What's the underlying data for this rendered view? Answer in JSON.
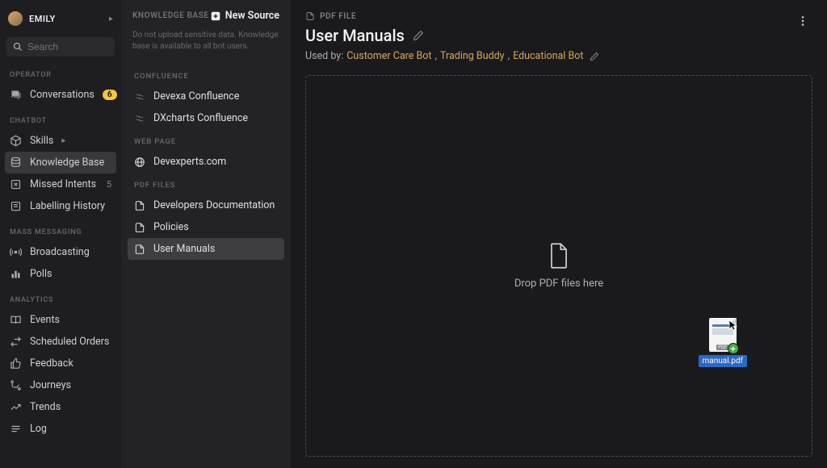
{
  "user": {
    "name": "EMILY"
  },
  "search": {
    "placeholder": "Search"
  },
  "sidebar_sections": {
    "operator": {
      "label": "OPERATOR"
    },
    "chatbot": {
      "label": "CHATBOT"
    },
    "mass_messaging": {
      "label": "MASS MESSAGING"
    },
    "analytics": {
      "label": "ANALYTICS"
    }
  },
  "nav": {
    "conversations": {
      "label": "Conversations",
      "badge": "6"
    },
    "skills": {
      "label": "Skills"
    },
    "knowledge_base": {
      "label": "Knowledge Base"
    },
    "missed_intents": {
      "label": "Missed Intents",
      "count": "5"
    },
    "labelling_history": {
      "label": "Labelling History"
    },
    "broadcasting": {
      "label": "Broadcasting"
    },
    "polls": {
      "label": "Polls"
    },
    "events": {
      "label": "Events"
    },
    "scheduled_orders": {
      "label": "Scheduled Orders"
    },
    "feedback": {
      "label": "Feedback"
    },
    "journeys": {
      "label": "Journeys"
    },
    "trends": {
      "label": "Trends"
    },
    "log": {
      "label": "Log"
    }
  },
  "kb_panel": {
    "title": "KNOWLEDGE BASE",
    "new_source": "New Source",
    "note": "Do not upload sensitive data. Knowledge base is available to all bot users.",
    "sections": {
      "confluence": {
        "label": "CONFLUENCE"
      },
      "web_page": {
        "label": "WEB PAGE"
      },
      "pdf_files": {
        "label": "PDF FILES"
      }
    },
    "confluence_items": [
      "Devexa Confluence",
      "DXcharts Confluence"
    ],
    "webpage_items": [
      "Devexperts.com"
    ],
    "pdf_items": [
      "Developers Documentation",
      "Policies",
      "User Manuals"
    ]
  },
  "main": {
    "breadcrumb": "PDF FILE",
    "title": "User Manuals",
    "used_by_label": "Used by:",
    "used_by_links": [
      "Customer Care Bot",
      "Trading Buddy",
      "Educational Bot"
    ],
    "drop_text": "Drop PDF files here",
    "dragged_file": "manual.pdf"
  }
}
